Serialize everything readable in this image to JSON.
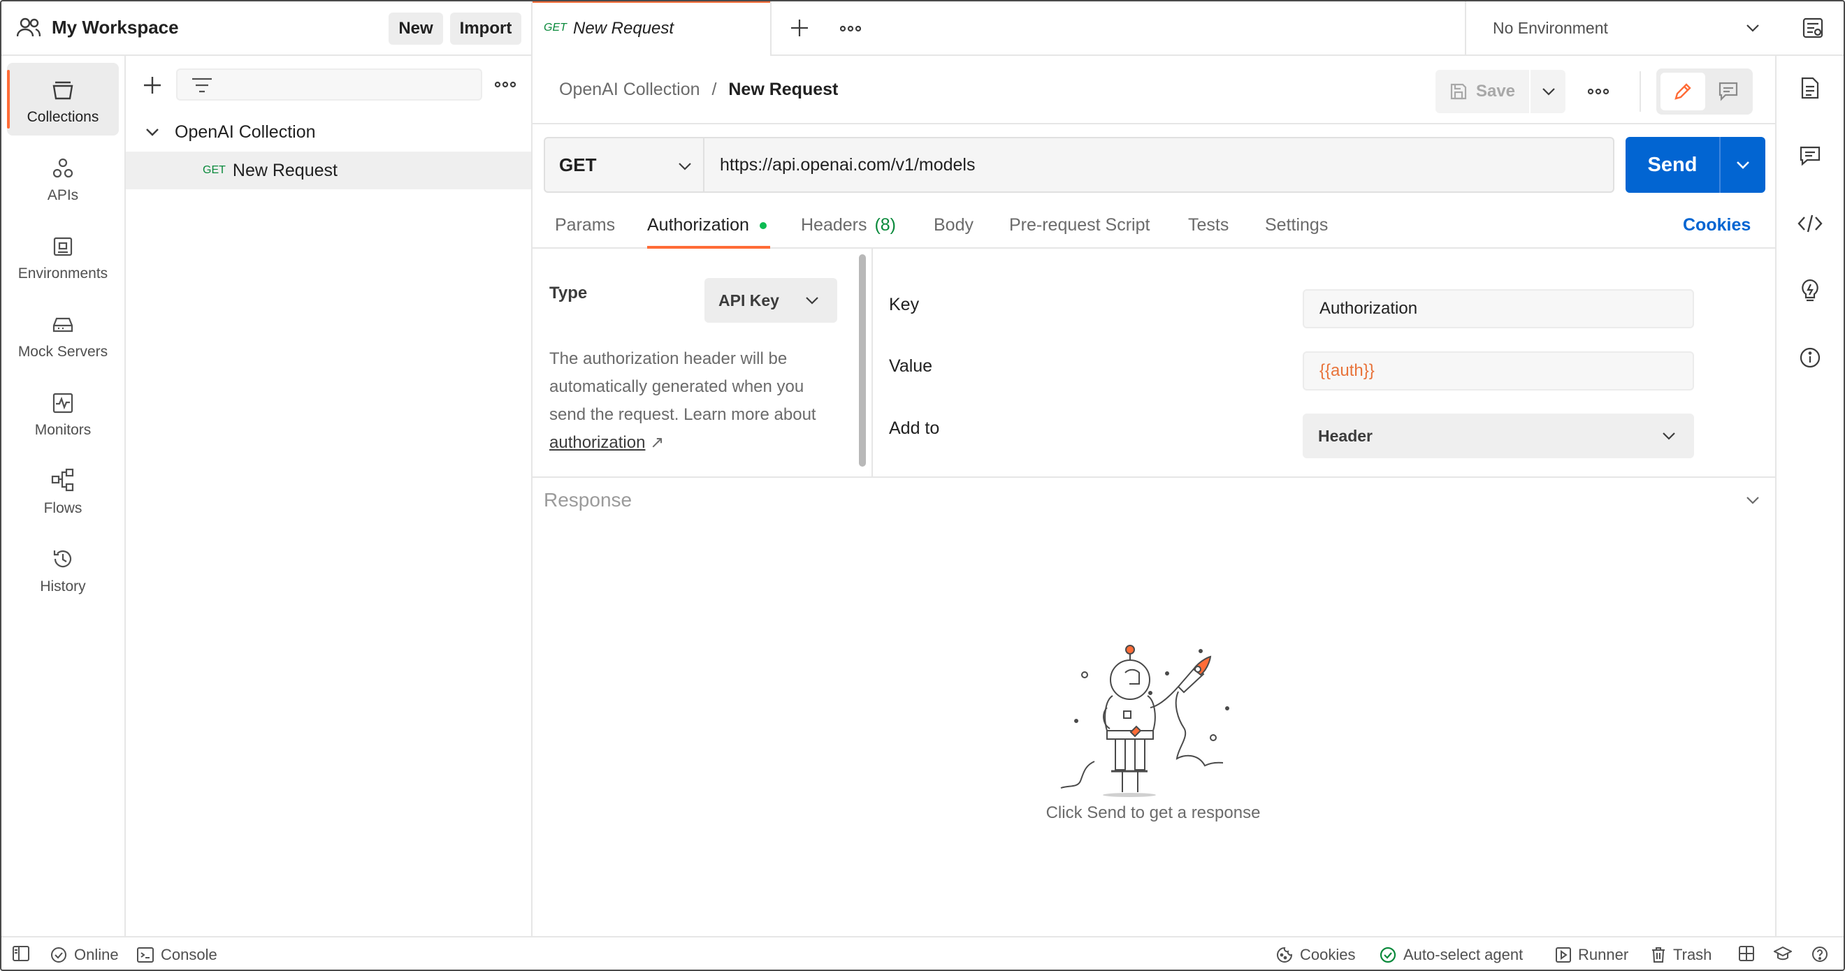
{
  "workspace": {
    "title": "My Workspace",
    "new_label": "New",
    "import_label": "Import"
  },
  "rail": {
    "items": [
      {
        "label": "Collections",
        "icon": "collections-icon",
        "active": true
      },
      {
        "label": "APIs",
        "icon": "apis-icon"
      },
      {
        "label": "Environments",
        "icon": "environments-icon"
      },
      {
        "label": "Mock Servers",
        "icon": "mock-servers-icon"
      },
      {
        "label": "Monitors",
        "icon": "monitors-icon"
      },
      {
        "label": "Flows",
        "icon": "flows-icon"
      },
      {
        "label": "History",
        "icon": "history-icon"
      }
    ]
  },
  "sidebar": {
    "collection_name": "OpenAI Collection",
    "request": {
      "method": "GET",
      "name": "New Request"
    }
  },
  "tabs": {
    "active": {
      "method": "GET",
      "name": "New Request"
    },
    "environment": "No Environment"
  },
  "breadcrumb": {
    "collection": "OpenAI Collection",
    "separator": "/",
    "request": "New Request"
  },
  "toolbar": {
    "save_label": "Save"
  },
  "request": {
    "method": "GET",
    "url": "https://api.openai.com/v1/models",
    "send_label": "Send"
  },
  "request_tabs": {
    "params": "Params",
    "authorization": "Authorization",
    "headers": "Headers",
    "headers_count": "(8)",
    "body": "Body",
    "prerequest": "Pre-request Script",
    "tests": "Tests",
    "settings": "Settings",
    "cookies": "Cookies"
  },
  "auth": {
    "type_label": "Type",
    "type_value": "API Key",
    "help_text": "The authorization header will be automatically generated when you send the request. Learn more about",
    "help_link": "authorization",
    "key_label": "Key",
    "key_value": "Authorization",
    "value_label": "Value",
    "value_value": "{{auth}}",
    "addto_label": "Add to",
    "addto_value": "Header"
  },
  "response": {
    "title": "Response",
    "empty_text": "Click Send to get a response"
  },
  "statusbar": {
    "online": "Online",
    "console": "Console",
    "cookies": "Cookies",
    "agent": "Auto-select agent",
    "runner": "Runner",
    "trash": "Trash"
  },
  "colors": {
    "accent": "#ff6c37",
    "primary": "#0265d2",
    "get": "#0b8a3c",
    "variable": "#e8733a",
    "status_ok": "#0b8a3c"
  }
}
